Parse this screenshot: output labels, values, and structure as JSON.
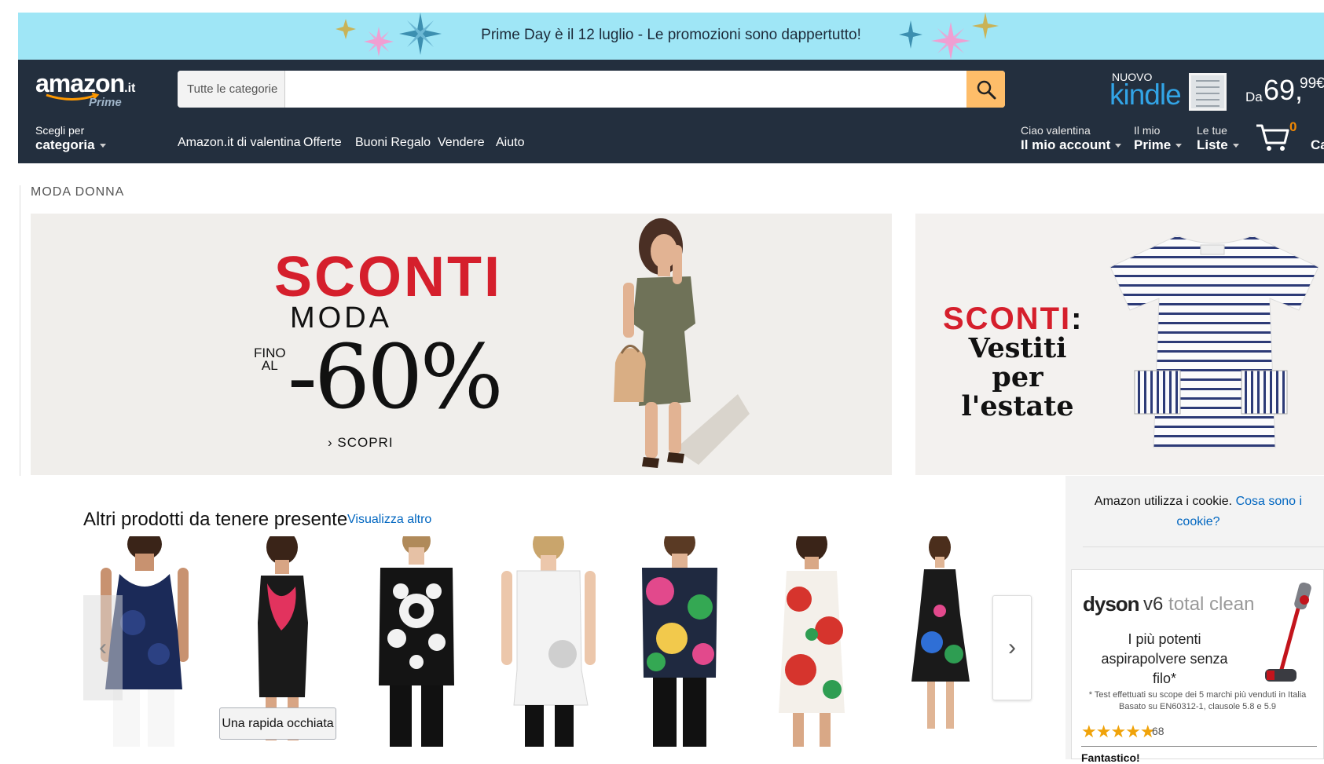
{
  "promo": {
    "text": "Prime Day è il 12 luglio - Le promozioni sono dappertutto!"
  },
  "header": {
    "logo": "amazon",
    "logo_tld": ".it",
    "logo_prime": "Prime",
    "search": {
      "category": "Tutte le categorie",
      "placeholder": ""
    },
    "kindle": {
      "tag": "NUOVO",
      "name": "kindle",
      "price_prefix": "Da",
      "price": "69,",
      "price_suffix": "99€"
    },
    "category_menu": {
      "small": "Scegli per",
      "big": "categoria"
    },
    "nav_links": [
      "Amazon.it di valentina",
      "Offerte",
      "Buoni Regalo",
      "Vendere",
      "Aiuto"
    ],
    "account": {
      "small": "Ciao valentina",
      "big": "Il mio account"
    },
    "prime": {
      "small": "Il mio",
      "big": "Prime"
    },
    "lists": {
      "small": "Le tue",
      "big": "Liste"
    },
    "cart": {
      "count": "0",
      "label": "Carrello"
    }
  },
  "section_label": "MODA DONNA",
  "banner_main": {
    "headline": "SCONTI",
    "sub": "MODA",
    "fino": "FINO",
    "al": "AL",
    "percent": "-60%",
    "cta": "› SCOPRI"
  },
  "banner_side": {
    "headline": "SCONTI",
    "colon": ":",
    "line1": "Vestiti per",
    "line2": "l'estate"
  },
  "related": {
    "title": "Altri prodotti da tenere presente",
    "more_link": "Visualizza altro",
    "quick_look": "Una rapida occhiata",
    "prev": "‹",
    "next": "›"
  },
  "cookie": {
    "text": "Amazon utilizza i cookie. ",
    "link": "Cosa sono i cookie?"
  },
  "ad": {
    "brand": "dyson",
    "model": "v6",
    "model_suffix": " total clean",
    "headline": "I più potenti aspirapolvere senza filo*",
    "fine_print_1": "* Test effettuati su scope dei 5 marchi più venduti in Italia",
    "fine_print_2": "Basato su EN60312-1, clausole 5.8 e 5.9",
    "stars": "★★★★★",
    "rating": 4.5,
    "review_count": "68",
    "review_title": "Fantastico!"
  },
  "colors": {
    "promo_bg": "#9fe6f6",
    "header_bg": "#232f3e",
    "search_button": "#febd69",
    "accent_red": "#d51f2c",
    "link_blue": "#0066c0",
    "kindle_blue": "#32a4e6"
  },
  "icons": [
    "search-icon",
    "cart-icon",
    "chevron-left-icon",
    "chevron-right-icon",
    "star-icon"
  ]
}
